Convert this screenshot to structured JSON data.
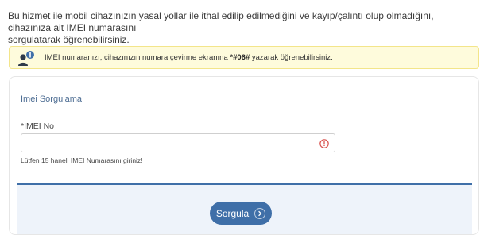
{
  "intro": {
    "line1": "Bu hizmet ile mobil cihazınızın yasal yollar ile ithal edilip edilmediğini ve kayıp/çalıntı olup olmadığını, cihazınıza ait IMEI numarasını",
    "line2": "sorgulatarak öğrenebilirsiniz."
  },
  "notice": {
    "icon": "user-info-icon",
    "text_before": "IMEI numaranızı, cihazınızın numara çevirme ekranına ",
    "code": "*#06#",
    "text_after": " yazarak öğrenebilirsiniz."
  },
  "form": {
    "title": "Imei Sorgulama",
    "field_label": "*IMEI No",
    "input_value": "",
    "input_placeholder": "",
    "warning_icon": "exclamation-circle-icon",
    "hint": "Lütfen 15 haneli IMEI Numarasını giriniz!",
    "submit_label": "Sorgula",
    "submit_icon": "chevron-right-icon"
  },
  "colors": {
    "accent": "#3f6fa8",
    "notice_bg": "#fefbdc",
    "notice_border": "#f3e58a",
    "warning": "#d9534f",
    "title": "#4d6d93"
  }
}
